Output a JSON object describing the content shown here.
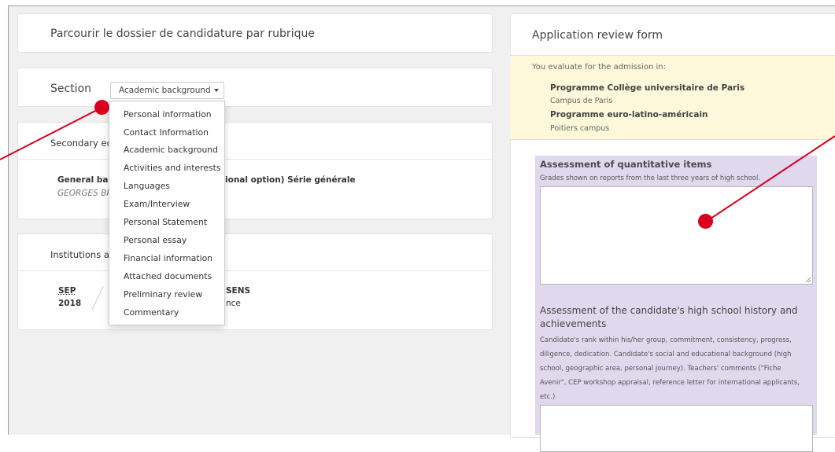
{
  "left": {
    "browse_title": "Parcourir le dossier de candidature par rubrique",
    "section_label": "Section",
    "section_dropdown": "Academic background",
    "secondary_title": "Secondary ed",
    "diploma_prefix": "General bacc",
    "diploma_suffix": "ional option) Série générale",
    "school_prefix": "GEORGES BRA",
    "institutions_title": "Institutions a",
    "inst_month": "SEP",
    "inst_year": "2018",
    "inst_name_suffix": "SENS",
    "inst_country_suffix": "nce"
  },
  "menu": {
    "items": [
      "Personal information",
      "Contact Information",
      "Academic background",
      "Activities and interests",
      "Languages",
      "Exam/Interview",
      "Personal Statement",
      "Personal essay",
      "Financial information",
      "Attached documents",
      "Preliminary review",
      "Commentary"
    ]
  },
  "right": {
    "form_title": "Application review form",
    "evaluate_text": "You evaluate for the admission in:",
    "program1": "Programme Collège universitaire de Paris",
    "campus1": "Campus de Paris",
    "program2": "Programme euro-latino-américain",
    "campus2": "Poitiers campus",
    "q1_title": "Assessment of quantitative items",
    "q1_desc": "Grades shown on reports from the last three years of high school.",
    "q2_title_line1": "Assessment of the candidate's high school history and",
    "q2_title_line2": "achievements",
    "q2_desc_line1": "Candidate's rank within his/her group, commitment, consistency, progress,",
    "q2_desc_line2": "diligence, dedication. Candidate's social and educational background (high",
    "q2_desc_line3": "school, geographic area, personal journey). Teachers' comments (\"Fiche",
    "q2_desc_line4": "Avenir\", CEP workshop appraisal, reference letter for international applicants,",
    "q2_desc_line5": "etc.)"
  },
  "colors": {
    "annotation_red": "#d9001f",
    "yellow_box": "#fcf8d9",
    "purple_box": "#e0d9ee"
  }
}
